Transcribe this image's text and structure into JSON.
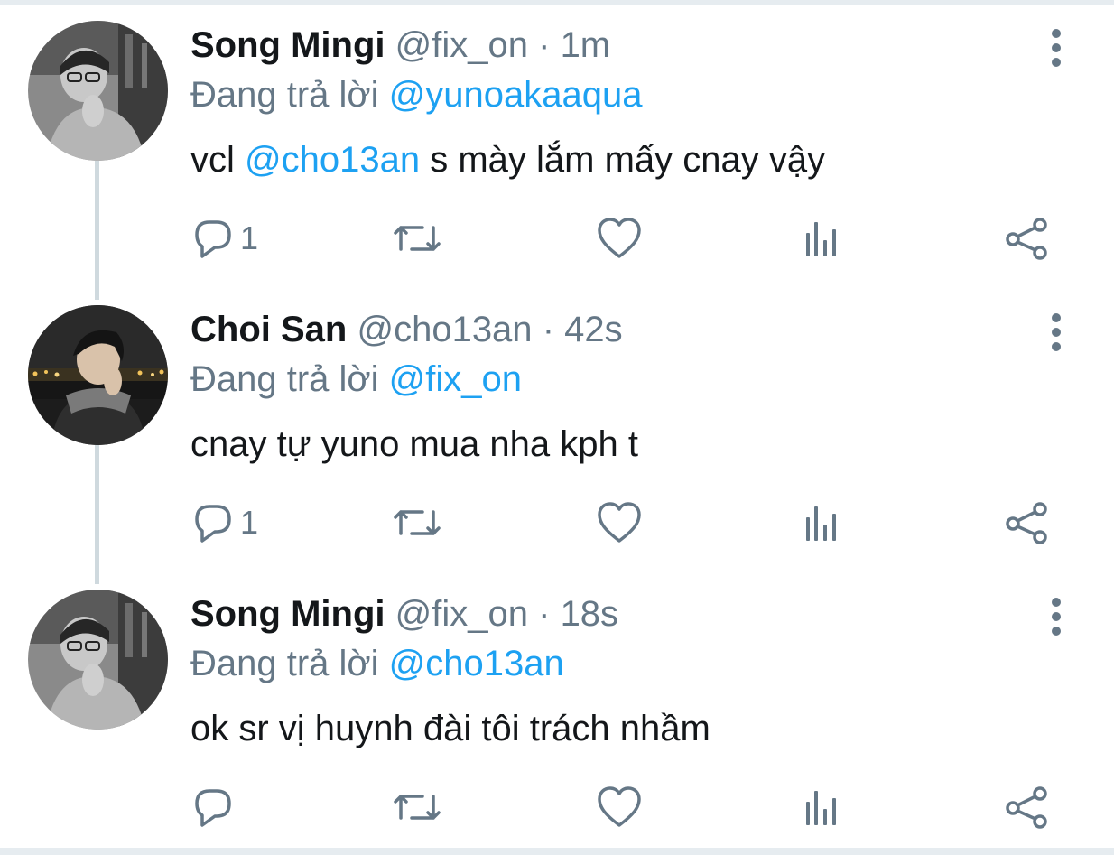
{
  "tweets": [
    {
      "display_name": "Song Mingi",
      "handle": "@fix_on",
      "separator": "·",
      "time": "1m",
      "replying_prefix": "Đang trả lời",
      "replying_to": "@yunoakaaqua",
      "text_before": "vcl ",
      "text_mention": "@cho13an",
      "text_after": " s mày lắm mấy cnay vậy",
      "reply_count": "1",
      "avatar": "grayscale-photo"
    },
    {
      "display_name": "Choi San",
      "handle": "@cho13an",
      "separator": "·",
      "time": "42s",
      "replying_prefix": "Đang trả lời",
      "replying_to": "@fix_on",
      "text_before": "cnay tự yuno mua nha kph t",
      "text_mention": "",
      "text_after": "",
      "reply_count": "1",
      "avatar": "night-city-photo"
    },
    {
      "display_name": "Song Mingi",
      "handle": "@fix_on",
      "separator": "·",
      "time": "18s",
      "replying_prefix": "Đang trả lời",
      "replying_to": "@cho13an",
      "text_before": "ok sr vị huynh đài tôi trách nhầm",
      "text_mention": "",
      "text_after": "",
      "reply_count": "",
      "avatar": "grayscale-photo"
    }
  ],
  "icons": {
    "reply": "reply-icon",
    "retweet": "retweet-icon",
    "like": "heart-icon",
    "stats": "stats-icon",
    "share": "share-icon",
    "more": "more-vertical-icon"
  },
  "colors": {
    "text": "#14171a",
    "muted": "#657786",
    "link": "#1da1f2",
    "thread_line": "#cfd9de",
    "border": "#e6ecf0"
  }
}
